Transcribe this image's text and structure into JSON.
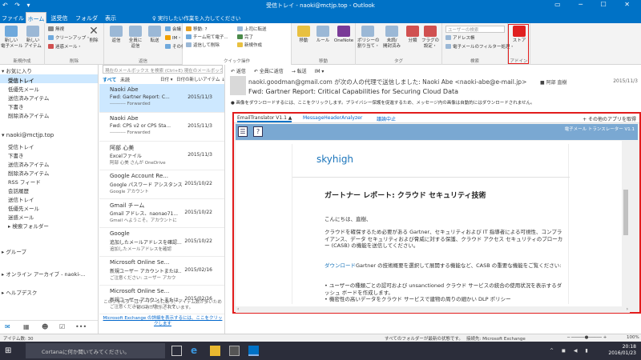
{
  "window": {
    "title": "受信トレイ - naoki@mctjp.top - Outlook",
    "quick_access": "↶ ↷ ▾",
    "controls": "▭ ─ ☐ ✕"
  },
  "tabs": [
    "ファイル",
    "ホーム",
    "送受信",
    "フォルダー",
    "表示"
  ],
  "tell_me": "♀ 実行したい作業を入力してください",
  "ribbon": {
    "groups": {
      "new": {
        "label": "新規作成",
        "new_mail": "新しい\n電子メール",
        "new_items": "新しい\nアイテム"
      },
      "delete": {
        "label": "削除",
        "ignore": "無視",
        "cleanup": "クリーンアップ・",
        "junk": "迷惑メール・",
        "delete": "削除"
      },
      "respond": {
        "label": "返信",
        "reply": "返信",
        "reply_all": "全員に\n返信",
        "forward": "転送",
        "meeting": "会議",
        "im": "IM・",
        "more": "その他・"
      },
      "quick_steps": {
        "label": "クイック操作",
        "move_to": "移動: ?",
        "team_email": "チーム宛て電子...",
        "reply_delete": "返信して削除",
        "to_manager": "上司に転送",
        "done": "完了",
        "create_new": "新規作成"
      },
      "move": {
        "label": "移動",
        "move": "移動",
        "rules": "ルール",
        "onenote": "OneNote"
      },
      "tags": {
        "label": "タグ",
        "unread": "未読/\n開封済み",
        "categorize": "分類",
        "follow_up": "フラグの\n設定・",
        "assign_policy": "ポリシーの\n割り当て・"
      },
      "find": {
        "label": "検索",
        "search_people": "ユーザーの検索",
        "address_book": "アドレス帳",
        "filter_email": "電子メールのフィルター処理・"
      },
      "addins": {
        "label": "アドイン",
        "store": "ストア"
      }
    }
  },
  "folders": {
    "favorites": "お気に入り",
    "fav_items": [
      "受信トレイ",
      "低優先メール",
      "送信済みアイテム",
      "下書き",
      "削除済みアイテム"
    ],
    "account": "naoki@mctjp.top",
    "account_items": [
      "受信トレイ",
      "下書き",
      "送信済みアイテム",
      "削除済みアイテム",
      "RSS フィード",
      "会話履歴",
      "送信トレイ",
      "低優先メール",
      "迷惑メール",
      "検索フォルダー"
    ],
    "group": "グループ",
    "archive": "オンライン アーカイブ - naoki-...",
    "helpdesk": "ヘルプデスク"
  },
  "message_list": {
    "search_placeholder": "現在のメールボックス を検索 (Ctrl+E)  現在のメールボックス ▾",
    "filter_all": "すべて",
    "filter_unread": "未読",
    "sort": "日付 ▾",
    "newest": "日付の新しいアイテム ↓",
    "items": [
      {
        "sender": "Naoki Abe",
        "subject": "Fwd: Gartner Report: C...",
        "date": "2015/11/3",
        "preview": "---------- Forwarded"
      },
      {
        "sender": "Naoki Abe",
        "subject": "Fwd: CPS v2 or CPS Sta...",
        "date": "2015/11/3",
        "preview": "---------- Forwarded"
      },
      {
        "sender": "阿部 心美",
        "subject": "Excelファイル",
        "date": "2015/11/3",
        "preview": "阿部 心美 さんが OneDrive"
      },
      {
        "sender": "Google Account Re...",
        "subject": "Google パスワード アシスタンス",
        "date": "2015/10/22",
        "preview": "Google アカウント"
      },
      {
        "sender": "Gmail チーム",
        "subject": "Gmail アドレス、naonao71...",
        "date": "2015/10/22",
        "preview": "Gmail へようこそ。アカウントに"
      },
      {
        "sender": "Google",
        "subject": "追加したメールアドレスを確認...",
        "date": "2015/10/22",
        "preview": "追加したメールアドレスを確認"
      },
      {
        "sender": "Microsoft Online Se...",
        "subject": "新規ユーザー アカウントまたは...",
        "date": "2015/02/16",
        "preview": "ご注意ください: ユーザー アカウ"
      },
      {
        "sender": "Microsoft Online Se...",
        "subject": "新規ユーザー アカウントまたは...",
        "date": "2015/02/16",
        "preview": "ご注意ください: ユーザー アカウ"
      }
    ],
    "footer_note": "このフォルダーはサーバー上にあり、アイテム数が多いため一部のみが表示されています。",
    "footer_link": "Microsoft Exchange の詳細を表示するには、ここをクリックします"
  },
  "reading": {
    "actions": [
      "↶ 返信",
      "↶ 全員に返信",
      "→ 転送",
      "IM ▾"
    ],
    "from": "naoki.goodman@gmail.com が次の人の代理で送信しました: Naoki Abe <naoki-abe@e-mail.jp>",
    "subject": "Fwd: Gartner Report: Critical Capabilities for Securing Cloud Data",
    "to": "■ 阿部 直樹",
    "date": "2015/11/3",
    "info_bar": "● 画像をダウンロードするには、ここをクリックします。プライバシー保護を促進するため、メッセージ内の画像は自動的にはダウンロードされません。"
  },
  "addin": {
    "tabs": [
      "EmailTranslator V1.1 ▲",
      "MessageHeaderAnalyzer",
      "議論中止"
    ],
    "get_more": "+ その他のアプリを取得",
    "bar_title": "電子メール トランスレーター V1.1",
    "logo": "skyhigh",
    "heading": "ガートナー レポート: クラウド セキュリティ技術",
    "greeting": "こんにちは、直樹、",
    "p1": "クラウドを確保するため必要がある Gartner、セキュリティおよび IT 指導者による可視性、コンプライアンス、データ セキュリティおよび脅威に対する保護、クラウド アクセス セキュリティのブローカー (CASB) の機能を送信してください。",
    "p2_link": "ダウンロード",
    "p2": "Gartner の技術概要を選択して展開する機能など、CASB の重要な機能をご覧ください:",
    "bullet1": "• ユーザーの種類ごとの認可および unsanctioned クラウド サービスの統合の使用状況を表示するダッシュ ボードを作成します。",
    "bullet2": "• 機密性の高いデータをクラウド サービスで建物の周りの細かい DLP ポリシー"
  },
  "status": {
    "items": "アイテム数: 30",
    "sync": "すべてのフォルダーが最新の状態です。",
    "connection": "接続先: Microsoft Exchange",
    "zoom": "100%"
  },
  "taskbar": {
    "search": "Cortanaに何か聞いてみてください。",
    "time": "20:18",
    "date": "2016/01/23"
  },
  "colors": {
    "brand": "#0072c6",
    "highlight": "#e21c1c",
    "selection": "#cde8ff"
  }
}
